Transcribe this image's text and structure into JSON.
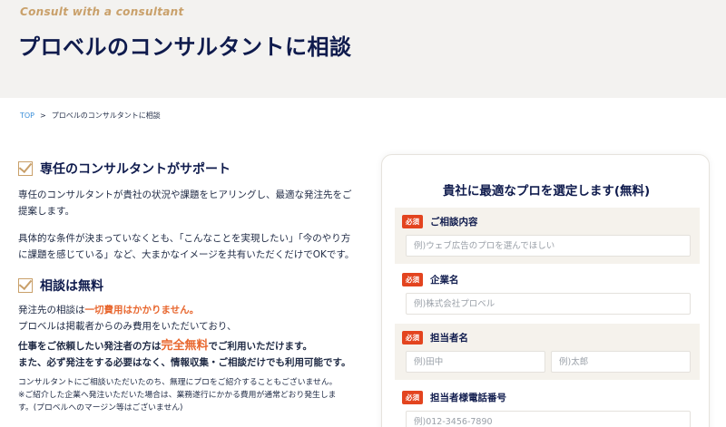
{
  "hero": {
    "subtitle_en": "Consult with a consultant",
    "title": "プロベルのコンサルタントに相談"
  },
  "breadcrumb": {
    "home": "TOP",
    "separator": ">",
    "current": "プロベルのコンサルタントに相談"
  },
  "section1": {
    "title": "専任のコンサルタントがサポート",
    "p1_line1": "専任のコンサルタントが貴社の状況や課題をヒアリングし、最適な発注先をご",
    "p1_line2": "提案します。",
    "p2_line1": "具体的な条件が決まっていなくとも、「こんなことを実現したい」「今のやり方",
    "p2_line2": "に課題を感じている」など、大まかなイメージを共有いただくだけでOKです。"
  },
  "section2": {
    "title": "相談は無料",
    "line1_a": "発注先の相談は",
    "line1_b": "一切費用はかかりません。",
    "line2": "プロベルは掲載者からのみ費用をいただいており、",
    "line3_a": "仕事をご依頼したい発注者の方は",
    "line3_b": "完全無料",
    "line3_c": "でご利用いただけます。",
    "line4": "また、必ず発注をする必要はなく、情報収集・ご相談だけでも利用可能です。",
    "note1": "コンサルタントにご相談いただいたのち、無理にプロをご紹介することもございません。",
    "note2": "※ご紹介した企業へ発注いただいた場合は、業務遂行にかかる費用が通常どおり発生しま",
    "note3": "す。(プロベルへのマージン等はございません)"
  },
  "form": {
    "title": "貴社に最適なプロを選定します(無料)",
    "required_label": "必須",
    "consultation": {
      "label": "ご相談内容",
      "placeholder": "例)ウェブ広告のプロを選んでほしい"
    },
    "company": {
      "label": "企業名",
      "placeholder": "例)株式会社プロベル"
    },
    "person": {
      "label": "担当者名",
      "last_placeholder": "例)田中",
      "first_placeholder": "例)太郎"
    },
    "phone": {
      "label": "担当者様電話番号",
      "placeholder": "例)012-3456-7890"
    }
  },
  "colors": {
    "navy": "#0f1b4d",
    "gold": "#c9a06a",
    "orange": "#e8672f",
    "required_red": "#e3441f",
    "link_blue": "#3b8fd9"
  }
}
